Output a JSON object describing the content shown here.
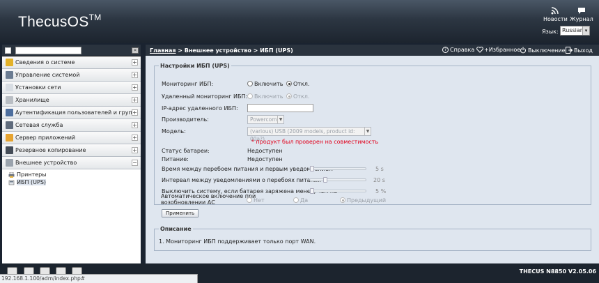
{
  "header": {
    "logo": "ThecusOS",
    "logo_tm": "TM",
    "news_label": "Новости",
    "log_label": "Журнал",
    "lang_label": "Язык:",
    "lang_value": "Russian"
  },
  "sidebar": {
    "search_placeholder": "",
    "items": [
      {
        "label": "Сведения о системе",
        "icon_color": "#e3b22a",
        "expanded": false
      },
      {
        "label": "Управление системой",
        "icon_color": "#6b7c92",
        "expanded": false
      },
      {
        "label": "Установки сети",
        "icon_color": "#d8dde3",
        "expanded": false
      },
      {
        "label": "Хранилище",
        "icon_color": "#b9bec4",
        "expanded": false
      },
      {
        "label": "Аутентификация пользователей и групп",
        "icon_color": "#4d6e9e",
        "expanded": false
      },
      {
        "label": "Сетевая служба",
        "icon_color": "#5f6b7c",
        "expanded": false
      },
      {
        "label": "Сервер приложений",
        "icon_color": "#e6a330",
        "expanded": false
      },
      {
        "label": "Резервное копирование",
        "icon_color": "#444c57",
        "expanded": false
      },
      {
        "label": "Внешнее устройство",
        "icon_color": "#9aa3ad",
        "expanded": true
      }
    ],
    "sub_items": [
      {
        "label": "Принтеры"
      },
      {
        "label": "ИБП (UPS)"
      }
    ],
    "plus": "+",
    "minus": "−"
  },
  "toolbar": {
    "crumb_home": "Главная",
    "crumb_rest": " > Внешнее устройство > ИБП (UPS)",
    "help": "Справка",
    "favorites": "+Избранное",
    "shutdown": "Выключение",
    "logout": "Выход"
  },
  "ups": {
    "legend": "Настройки ИБП (UPS)",
    "monitoring_label": "Мониторинг ИБП:",
    "on_label": "Включить",
    "off_label": "Откл.",
    "remote_label": "Удаленный мониторинг ИБП:",
    "remote_on": "Включить",
    "remote_off": "Откл.",
    "ip_label": "IP-адрес удаленного ИБП:",
    "ip_value": "",
    "vendor_label": "Производитель:",
    "vendor_value": "Powercom",
    "model_label": "Модель:",
    "model_value": "(various) USB (2009 models, product id: 00a?)",
    "compat_warning": "* продукт был проверен на совместимость",
    "battery_label": "Статус батареи:",
    "battery_value": "Недоступен",
    "power_label": "Питание:",
    "power_value": "Недоступен",
    "first_notify_label": "Время между перебоем питания и первым уведомлением",
    "first_notify_value": "5 s",
    "first_notify_level": 0.0,
    "interval_label": "Интервал между уведомлениями о перебоях питания",
    "interval_value": "20 s",
    "interval_level": 0.25,
    "shutdown_label": "Выключить систему, если батарея заряжена менее, чем на",
    "shutdown_value": "5 %",
    "shutdown_level": 0.0,
    "auto_on_label1": "Автоматическое включение при",
    "auto_on_label2": "возобновлении АС",
    "auto_no": "Нет",
    "auto_yes": "Да",
    "auto_prev": "Предыдущий",
    "apply_button": "Применить"
  },
  "description": {
    "legend": "Описание",
    "text": "1. Мониторинг ИБП поддерживает только порт WAN."
  },
  "footer": {
    "version": "THECUS N8850 V2.05.06",
    "status_url": "192.168.1.100/adm/index.php#"
  }
}
